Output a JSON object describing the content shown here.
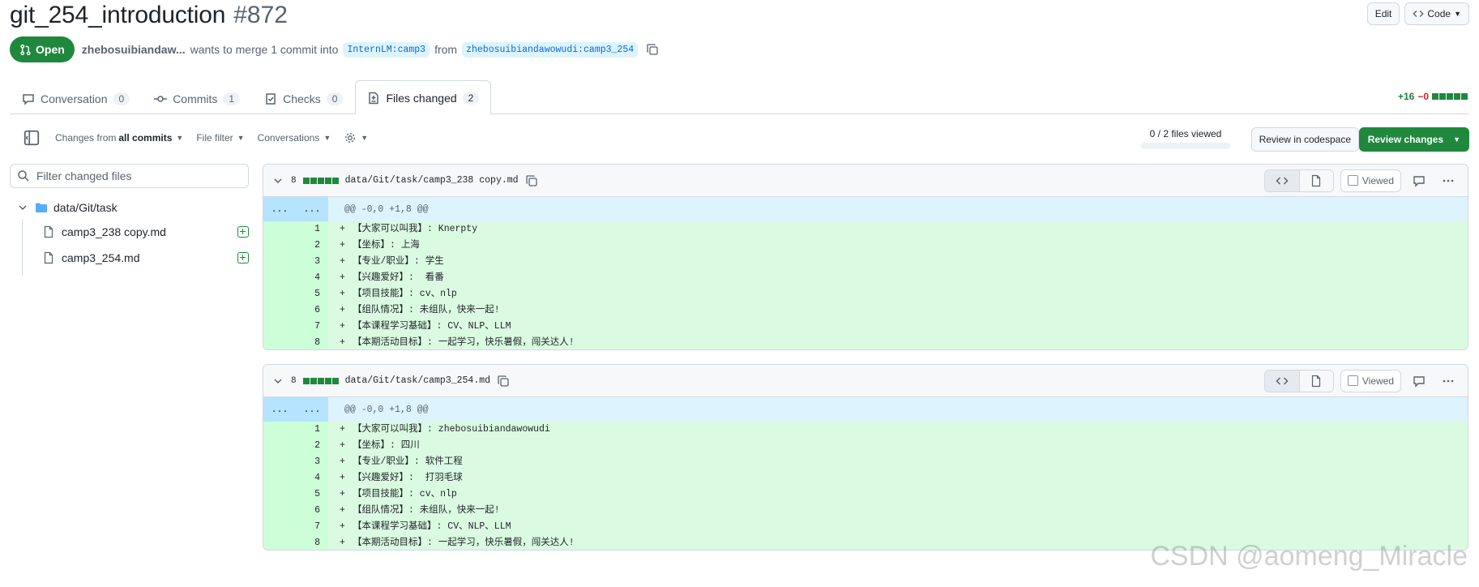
{
  "pr": {
    "title": "git_254_introduction",
    "number": "#872",
    "state": "Open",
    "author": "zhebosuibiandaw...",
    "merge_text": "wants to merge 1 commit into",
    "base_branch": "InternLM:camp3",
    "from_text": "from",
    "head_branch": "zhebosuibiandawowudi:camp3_254"
  },
  "header_actions": {
    "edit": "Edit",
    "code": "Code"
  },
  "tabs": [
    {
      "label": "Conversation",
      "count": "0",
      "icon": "comment-icon"
    },
    {
      "label": "Commits",
      "count": "1",
      "icon": "commit-icon"
    },
    {
      "label": "Checks",
      "count": "0",
      "icon": "checklist-icon"
    },
    {
      "label": "Files changed",
      "count": "2",
      "icon": "file-diff-icon"
    }
  ],
  "diffstat": {
    "added": "+16",
    "removed": "−0"
  },
  "toolbar": {
    "changes_from": "Changes from",
    "all_commits": "all commits",
    "file_filter": "File filter",
    "conversations": "Conversations",
    "files_viewed": "0 / 2 files viewed",
    "review_codespace": "Review in codespace",
    "review_changes": "Review changes"
  },
  "sidebar": {
    "filter_placeholder": "Filter changed files",
    "folder": "data/Git/task",
    "files": [
      "camp3_238 copy.md",
      "camp3_254.md"
    ]
  },
  "files": [
    {
      "count": "8",
      "path": "data/Git/task/camp3_238 copy.md",
      "viewed": "Viewed",
      "hunk_left": "...",
      "hunk_right": "...",
      "hunk": "@@ -0,0 +1,8 @@",
      "lines": [
        {
          "n": "1",
          "text": "【大家可以叫我】: Knerpty"
        },
        {
          "n": "2",
          "text": "【坐标】: 上海"
        },
        {
          "n": "3",
          "text": "【专业/职业】: 学生"
        },
        {
          "n": "4",
          "text": "【兴趣爱好】:  看番"
        },
        {
          "n": "5",
          "text": "【项目技能】: cv、nlp"
        },
        {
          "n": "6",
          "text": "【组队情况】: 未组队，快来一起!"
        },
        {
          "n": "7",
          "text": "【本课程学习基础】: CV、NLP、LLM"
        },
        {
          "n": "8",
          "text": "【本期活动目标】: 一起学习，快乐暑假，闯关达人!"
        }
      ]
    },
    {
      "count": "8",
      "path": "data/Git/task/camp3_254.md",
      "viewed": "Viewed",
      "hunk_left": "...",
      "hunk_right": "...",
      "hunk": "@@ -0,0 +1,8 @@",
      "lines": [
        {
          "n": "1",
          "text": "【大家可以叫我】: zhebosuibiandawowudi"
        },
        {
          "n": "2",
          "text": "【坐标】: 四川"
        },
        {
          "n": "3",
          "text": "【专业/职业】: 软件工程"
        },
        {
          "n": "4",
          "text": "【兴趣爱好】:  打羽毛球"
        },
        {
          "n": "5",
          "text": "【项目技能】: cv、nlp"
        },
        {
          "n": "6",
          "text": "【组队情况】: 未组队，快来一起!"
        },
        {
          "n": "7",
          "text": "【本课程学习基础】: CV、NLP、LLM"
        },
        {
          "n": "8",
          "text": "【本期活动目标】: 一起学习，快乐暑假，闯关达人!"
        }
      ]
    }
  ],
  "watermark": "CSDN @aomeng_Miracle",
  "colors": {
    "open_green": "#1f883d",
    "added_bg": "#dafbe1",
    "hunk_bg": "#ddf4ff",
    "link_blue": "#0969da"
  }
}
